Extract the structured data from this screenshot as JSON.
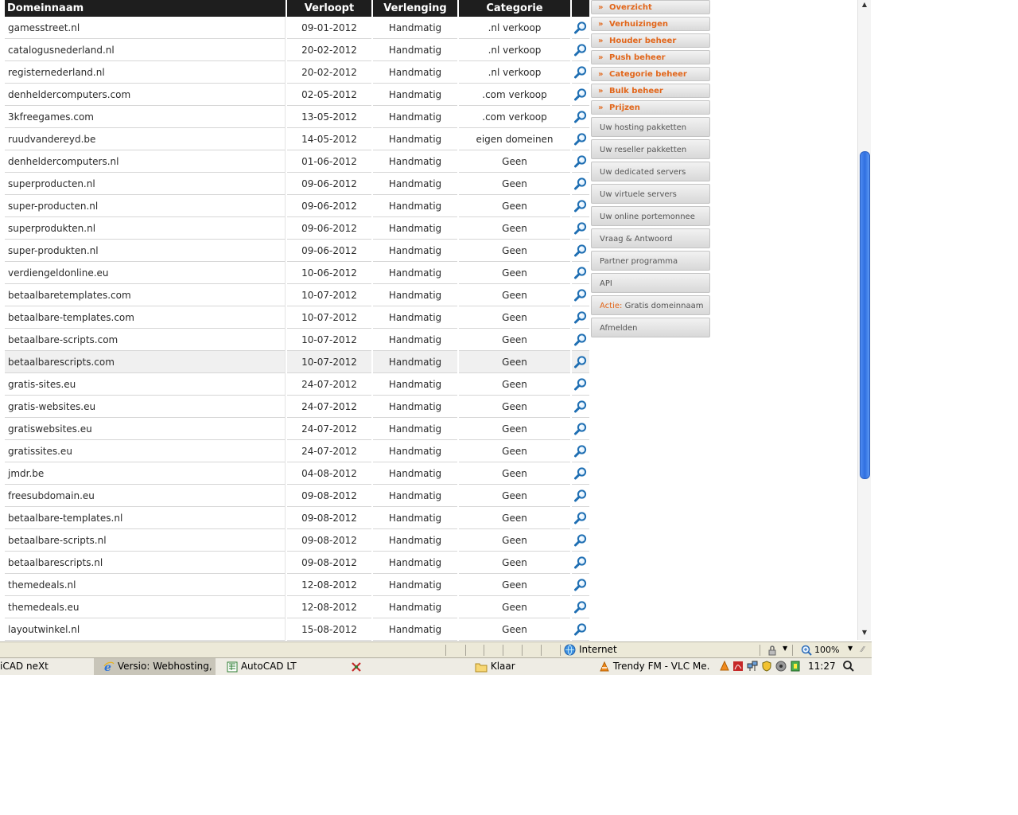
{
  "table": {
    "headers": [
      "Domeinnaam",
      "Verloopt",
      "Verlenging",
      "Categorie"
    ],
    "rows": [
      {
        "domain": "gamesstreet.nl",
        "expires": "09-01-2012",
        "renewal": "Handmatig",
        "category": ".nl verkoop"
      },
      {
        "domain": "catalogusnederland.nl",
        "expires": "20-02-2012",
        "renewal": "Handmatig",
        "category": ".nl verkoop"
      },
      {
        "domain": "registernederland.nl",
        "expires": "20-02-2012",
        "renewal": "Handmatig",
        "category": ".nl verkoop"
      },
      {
        "domain": "denheldercomputers.com",
        "expires": "02-05-2012",
        "renewal": "Handmatig",
        "category": ".com verkoop"
      },
      {
        "domain": "3kfreegames.com",
        "expires": "13-05-2012",
        "renewal": "Handmatig",
        "category": ".com verkoop"
      },
      {
        "domain": "ruudvandereyd.be",
        "expires": "14-05-2012",
        "renewal": "Handmatig",
        "category": "eigen domeinen"
      },
      {
        "domain": "denheldercomputers.nl",
        "expires": "01-06-2012",
        "renewal": "Handmatig",
        "category": "Geen"
      },
      {
        "domain": "superproducten.nl",
        "expires": "09-06-2012",
        "renewal": "Handmatig",
        "category": "Geen"
      },
      {
        "domain": "super-producten.nl",
        "expires": "09-06-2012",
        "renewal": "Handmatig",
        "category": "Geen"
      },
      {
        "domain": "superprodukten.nl",
        "expires": "09-06-2012",
        "renewal": "Handmatig",
        "category": "Geen"
      },
      {
        "domain": "super-produkten.nl",
        "expires": "09-06-2012",
        "renewal": "Handmatig",
        "category": "Geen"
      },
      {
        "domain": "verdiengeldonline.eu",
        "expires": "10-06-2012",
        "renewal": "Handmatig",
        "category": "Geen"
      },
      {
        "domain": "betaalbaretemplates.com",
        "expires": "10-07-2012",
        "renewal": "Handmatig",
        "category": "Geen"
      },
      {
        "domain": "betaalbare-templates.com",
        "expires": "10-07-2012",
        "renewal": "Handmatig",
        "category": "Geen"
      },
      {
        "domain": "betaalbare-scripts.com",
        "expires": "10-07-2012",
        "renewal": "Handmatig",
        "category": "Geen"
      },
      {
        "domain": "betaalbarescripts.com",
        "expires": "10-07-2012",
        "renewal": "Handmatig",
        "category": "Geen",
        "highlighted": true
      },
      {
        "domain": "gratis-sites.eu",
        "expires": "24-07-2012",
        "renewal": "Handmatig",
        "category": "Geen"
      },
      {
        "domain": "gratis-websites.eu",
        "expires": "24-07-2012",
        "renewal": "Handmatig",
        "category": "Geen"
      },
      {
        "domain": "gratiswebsites.eu",
        "expires": "24-07-2012",
        "renewal": "Handmatig",
        "category": "Geen"
      },
      {
        "domain": "gratissites.eu",
        "expires": "24-07-2012",
        "renewal": "Handmatig",
        "category": "Geen"
      },
      {
        "domain": "jmdr.be",
        "expires": "04-08-2012",
        "renewal": "Handmatig",
        "category": "Geen"
      },
      {
        "domain": "freesubdomain.eu",
        "expires": "09-08-2012",
        "renewal": "Handmatig",
        "category": "Geen"
      },
      {
        "domain": "betaalbare-templates.nl",
        "expires": "09-08-2012",
        "renewal": "Handmatig",
        "category": "Geen"
      },
      {
        "domain": "betaalbare-scripts.nl",
        "expires": "09-08-2012",
        "renewal": "Handmatig",
        "category": "Geen"
      },
      {
        "domain": "betaalbarescripts.nl",
        "expires": "09-08-2012",
        "renewal": "Handmatig",
        "category": "Geen"
      },
      {
        "domain": "themedeals.nl",
        "expires": "12-08-2012",
        "renewal": "Handmatig",
        "category": "Geen"
      },
      {
        "domain": "themedeals.eu",
        "expires": "12-08-2012",
        "renewal": "Handmatig",
        "category": "Geen"
      },
      {
        "domain": "layoutwinkel.nl",
        "expires": "15-08-2012",
        "renewal": "Handmatig",
        "category": "Geen"
      }
    ],
    "row_action_icon": "magnifier-icon"
  },
  "side_menu": {
    "sub_items": [
      "Overzicht",
      "Verhuizingen",
      "Houder beheer",
      "Push beheer",
      "Categorie beheer",
      "Bulk beheer",
      "Prijzen"
    ],
    "sub_item_prefix": "»",
    "items": [
      "Uw hosting pakketten",
      "Uw reseller pakketten",
      "Uw dedicated servers",
      "Uw virtuele servers",
      "Uw online portemonnee",
      "Vraag & Antwoord",
      "Partner programma",
      "API"
    ],
    "promo": {
      "accent": "Actie:",
      "text": " Gratis domeinnaam"
    },
    "logout": "Afmelden"
  },
  "status_bar": {
    "zone": "Internet",
    "zoom": "100%"
  },
  "taskbar": {
    "tasks": [
      {
        "label": "iCAD neXt",
        "active": false
      },
      {
        "label": "Versio: Webhosting, ...",
        "active": true
      },
      {
        "label": "AutoCAD LT",
        "active": false
      },
      {
        "label": "",
        "active": false
      },
      {
        "label": "Klaar",
        "active": false
      },
      {
        "label": "Trendy FM - VLC Me...",
        "active": false
      }
    ],
    "clock": "11:27"
  },
  "colors": {
    "accent_orange": "#e2661a",
    "header_dark": "#1e1e1e",
    "scroll_blue": "#2f6fe0"
  }
}
